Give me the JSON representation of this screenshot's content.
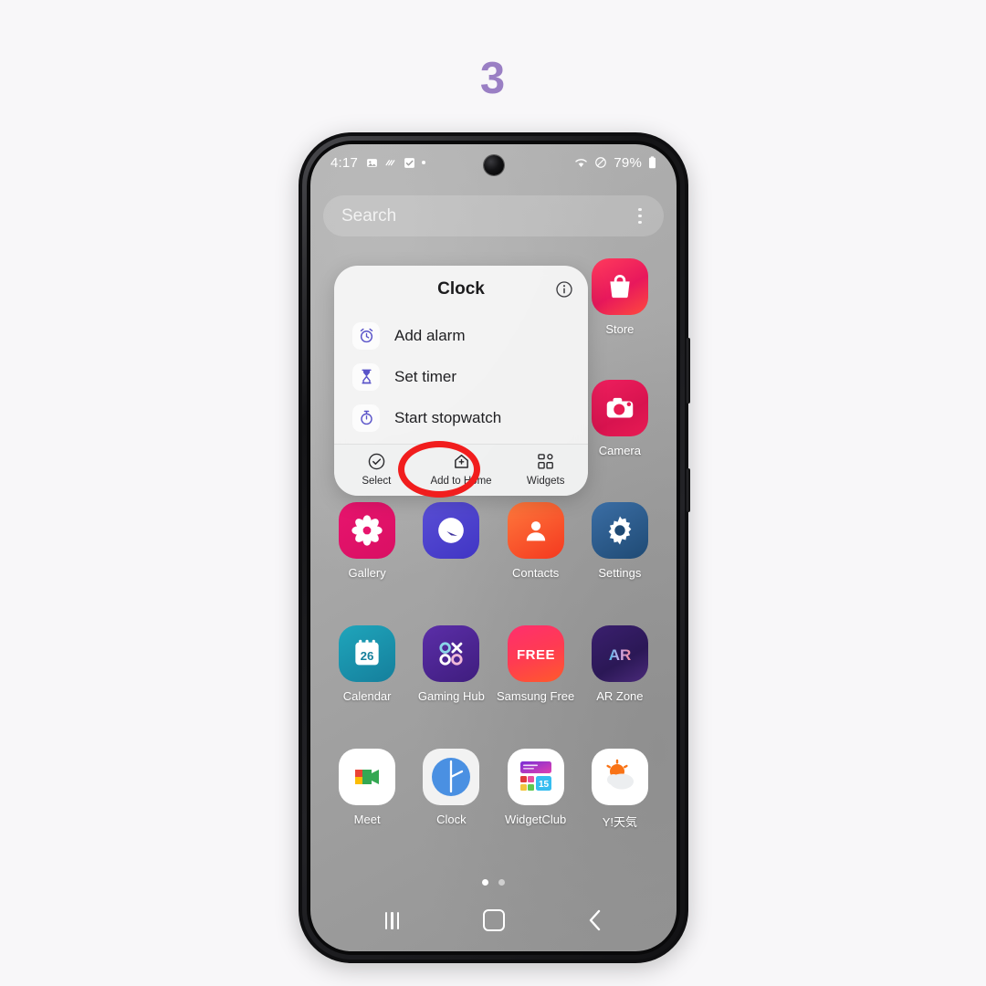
{
  "step": {
    "number": "3",
    "color": "#9a7fc4"
  },
  "status_bar": {
    "time": "4:17",
    "left_icons": [
      "image-icon",
      "vibrate-icon",
      "checkbox-icon",
      "dot-icon"
    ],
    "right_icons": [
      "wifi-icon",
      "mute-icon"
    ],
    "battery_percent": "79%",
    "battery_icon": "battery-icon"
  },
  "search": {
    "placeholder": "Search",
    "menu_icon": "kebab-menu-icon"
  },
  "popup": {
    "title": "Clock",
    "info_icon": "info-icon",
    "shortcuts": [
      {
        "label": "Add alarm",
        "icon": "alarm-clock-icon"
      },
      {
        "label": "Set timer",
        "icon": "hourglass-icon"
      },
      {
        "label": "Start stopwatch",
        "icon": "stopwatch-icon"
      }
    ],
    "actions": [
      {
        "label": "Select",
        "icon": "check-circle-icon"
      },
      {
        "label": "Add to Home",
        "icon": "add-to-home-icon",
        "highlighted": true
      },
      {
        "label": "Widgets",
        "icon": "widgets-grid-icon"
      }
    ],
    "highlight_color": "#f11d1d"
  },
  "app_grid": {
    "rows": [
      [
        {
          "label": "",
          "icon": "",
          "hidden": true
        },
        {
          "label": "",
          "icon": "",
          "hidden": true
        },
        {
          "label": "",
          "icon": "",
          "hidden": true
        },
        {
          "label": "Store",
          "icon": "galaxy-store-icon"
        }
      ],
      [
        {
          "label": "",
          "icon": "",
          "hidden": true
        },
        {
          "label": "",
          "icon": "",
          "hidden": true
        },
        {
          "label": "",
          "icon": "",
          "hidden": true
        },
        {
          "label": "Camera",
          "icon": "camera-icon"
        }
      ],
      [
        {
          "label": "Gallery",
          "icon": "gallery-icon"
        },
        {
          "label": "",
          "icon": "compass-icon",
          "no_label": true
        },
        {
          "label": "Contacts",
          "icon": "contacts-icon"
        },
        {
          "label": "Settings",
          "icon": "settings-gear-icon"
        }
      ],
      [
        {
          "label": "Calendar",
          "icon": "calendar-icon",
          "badge": "26"
        },
        {
          "label": "Gaming Hub",
          "icon": "gaming-hub-icon"
        },
        {
          "label": "Samsung Free",
          "icon": "samsung-free-icon",
          "badge": "FREE"
        },
        {
          "label": "AR Zone",
          "icon": "ar-zone-icon",
          "badge": "AR"
        }
      ],
      [
        {
          "label": "Meet",
          "icon": "google-meet-icon"
        },
        {
          "label": "Clock",
          "icon": "clock-icon"
        },
        {
          "label": "WidgetClub",
          "icon": "widgetclub-icon",
          "badge": "15"
        },
        {
          "label": "Y!天気",
          "icon": "yahoo-weather-icon"
        }
      ]
    ]
  },
  "page_indicator": {
    "total": 2,
    "active": 1
  },
  "nav_bar": {
    "recents_label": "recents-button",
    "home_label": "home-button",
    "back_label": "back-button"
  },
  "cursor": {
    "type": "hand-pointer-tap"
  }
}
